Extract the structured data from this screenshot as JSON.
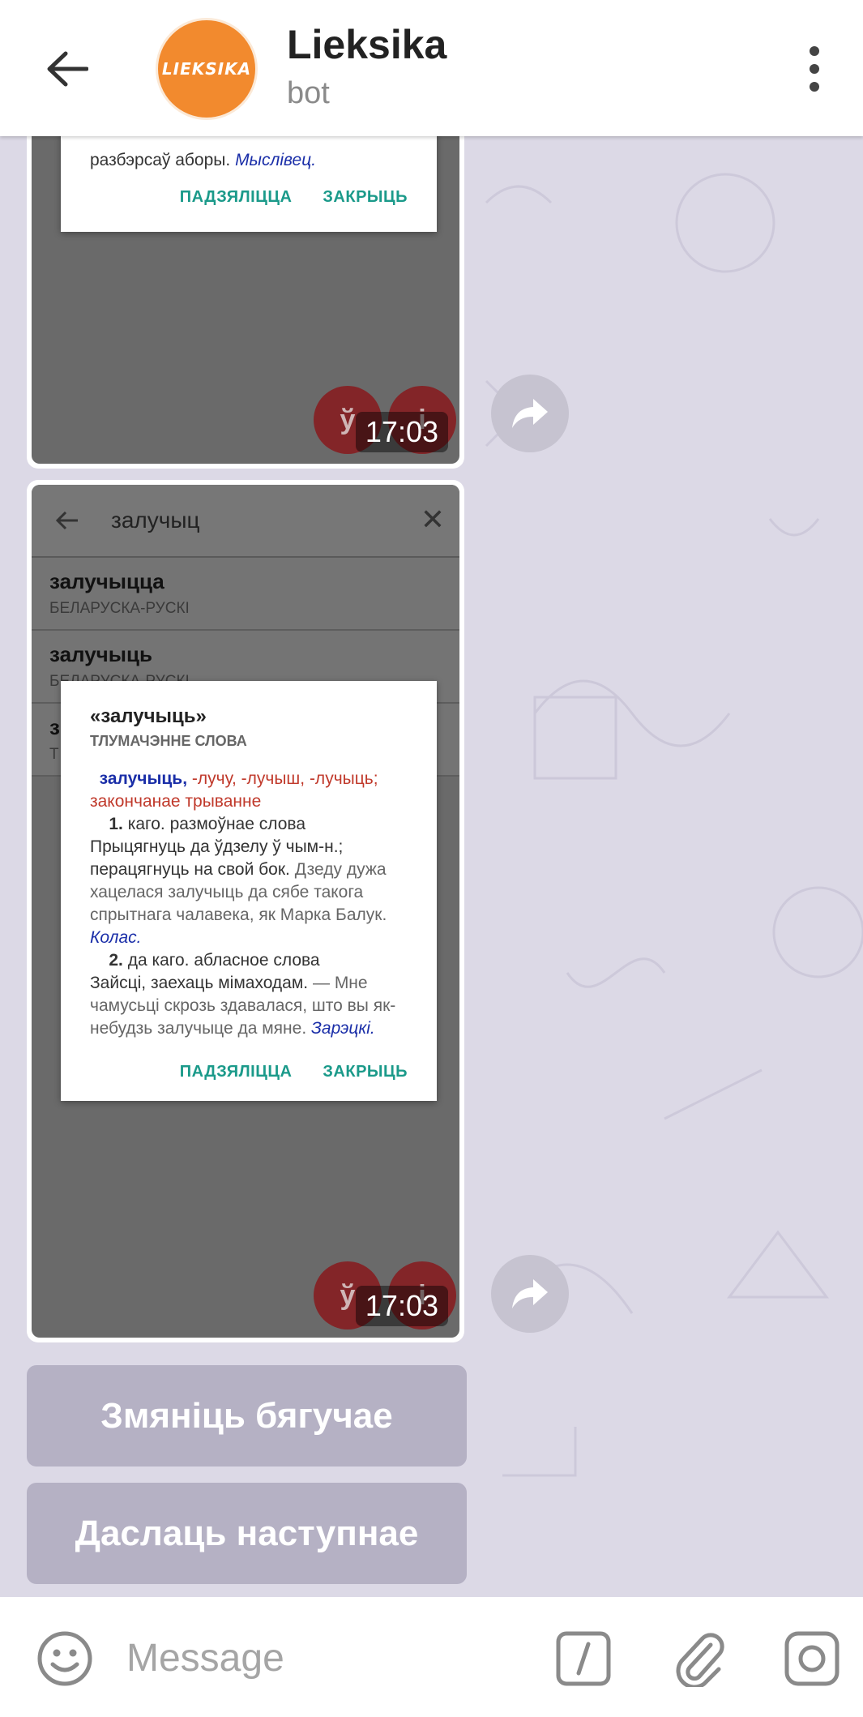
{
  "header": {
    "title": "Lieksika",
    "subtitle": "bot",
    "avatar_text": "LIEKSIKA",
    "avatar_color": "#f28a2e"
  },
  "messages": [
    {
      "time": "17:03",
      "dialog_tail_text": "разбэрсаў аборы.",
      "dialog_tail_author": "Мыслівец.",
      "actions": [
        "ПАДЗЯЛІЦЦА",
        "ЗАКРЫЦЬ"
      ],
      "fab_left": "ў",
      "fab_right": "і"
    },
    {
      "time": "17:03",
      "search_query": "залучыц",
      "results": [
        {
          "word": "залучыцца",
          "dict": "БЕЛАРУСКА-РУСКІ"
        },
        {
          "word": "залучыць",
          "dict": "БЕЛАРУСКА-РУСКІ"
        },
        {
          "word": "з",
          "dict": "Т"
        }
      ],
      "dialog": {
        "title": "«залучыць»",
        "subtitle": "ТЛУМАЧЭННЕ СЛОВА",
        "headword": "залучыць,",
        "forms": "-лучу, -лучыш, -лучыць;",
        "aspect": "закончанае трыванне",
        "s1_num": "1.",
        "s1_label": "каго. размоўнае слова",
        "s1_def": "Прыцягнуць да ўдзелу ў чым-н.; перацягнуць на свой бок.",
        "s1_example": "Дзеду дужа хацелася залучыць да сябе такога спрытнага чалавека, як Марка Балук.",
        "s1_author": "Колас.",
        "s2_num": "2.",
        "s2_label": "да каго. абласное слова",
        "s2_def": "Зайсці, заехаць мімаходам.",
        "s2_example": "— Мне чамусьці скрозь здавалася, што вы як-небудзь залучыце да мяне.",
        "s2_author": "Зарэцкі.",
        "actions": [
          "ПАДЗЯЛІЦЦА",
          "ЗАКРЫЦЬ"
        ]
      },
      "fab_left": "ў",
      "fab_right": "і"
    }
  ],
  "keyboard": {
    "buttons": [
      "Змяніць бягучае",
      "Даслаць наступнае"
    ]
  },
  "input": {
    "placeholder": "Message"
  }
}
